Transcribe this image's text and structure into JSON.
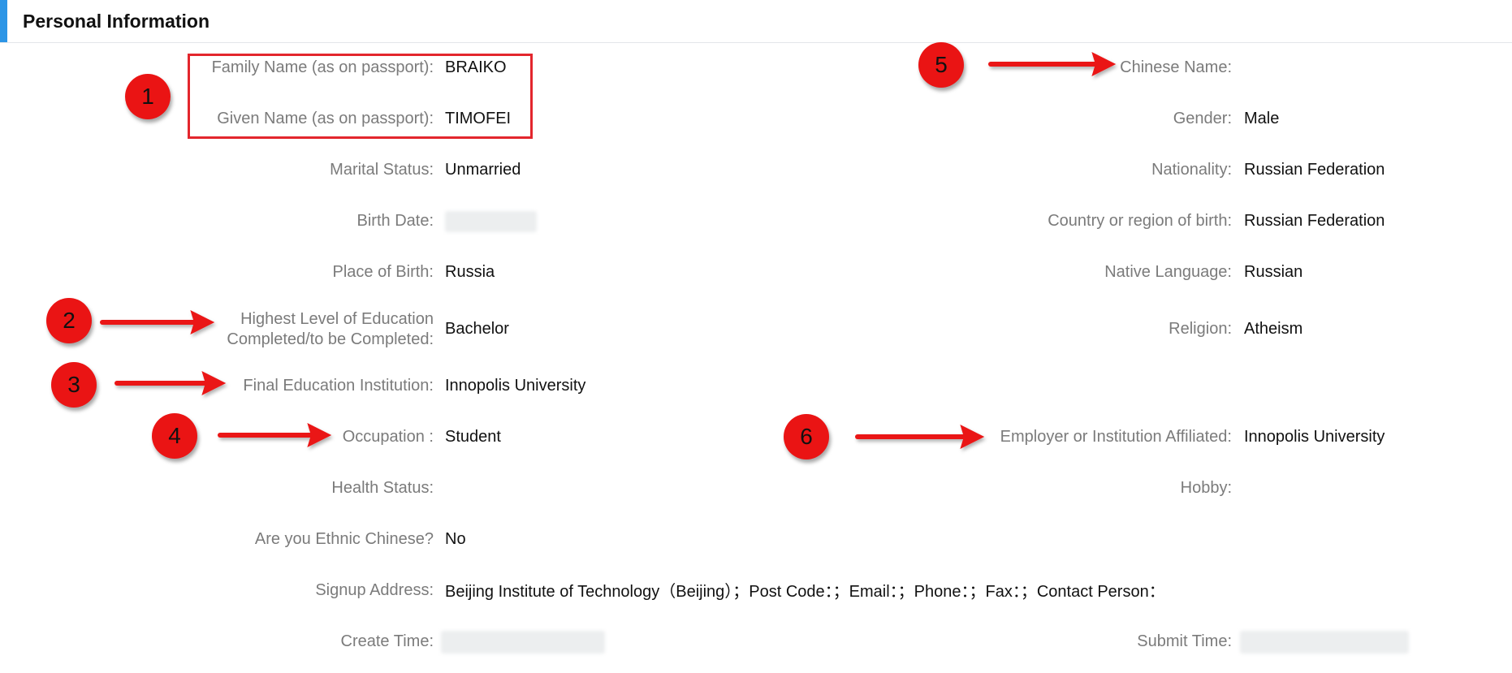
{
  "header": {
    "title": "Personal Information"
  },
  "left_fields": [
    {
      "label": "Family Name (as on passport):",
      "value": "BRAIKO"
    },
    {
      "label": "Given Name (as on passport):",
      "value": "TIMOFEI"
    },
    {
      "label": "Marital Status:",
      "value": "Unmarried"
    },
    {
      "label": "Birth Date:",
      "value": ""
    },
    {
      "label": "Place of Birth:",
      "value": "Russia"
    },
    {
      "label_line1": "Highest Level of Education",
      "label_line2": "Completed/to be Completed:",
      "value": "Bachelor"
    },
    {
      "label": "Final Education Institution:",
      "value": "Innopolis University"
    },
    {
      "label": "Occupation :",
      "value": "Student"
    },
    {
      "label": "Health Status:",
      "value": ""
    },
    {
      "label": "Are you Ethnic Chinese?",
      "value": "No"
    },
    {
      "label": "Signup Address:",
      "value": "Beijing Institute of Technology（Beijing）；Post Code：；Email：；Phone：；Fax：；Contact Person："
    },
    {
      "label": "Create Time:",
      "value": ""
    }
  ],
  "right_fields": [
    {
      "label": "Chinese Name:",
      "value": ""
    },
    {
      "label": "Gender:",
      "value": "Male"
    },
    {
      "label": "Nationality:",
      "value": "Russian Federation"
    },
    {
      "label": "Country or region of birth:",
      "value": "Russian Federation"
    },
    {
      "label": "Native Language:",
      "value": "Russian"
    },
    {
      "label": "Religion:",
      "value": "Atheism"
    },
    {
      "label": "Employer or Institution Affiliated:",
      "value": "Innopolis University"
    },
    {
      "label": "Hobby:",
      "value": ""
    },
    {
      "label": "Submit Time:",
      "value": ""
    }
  ],
  "annotations": [
    "1",
    "2",
    "3",
    "4",
    "5",
    "6"
  ],
  "colors": {
    "accent": "#2c95e6",
    "annotation_red": "#ea1414",
    "label_gray": "#7b7b7b"
  }
}
